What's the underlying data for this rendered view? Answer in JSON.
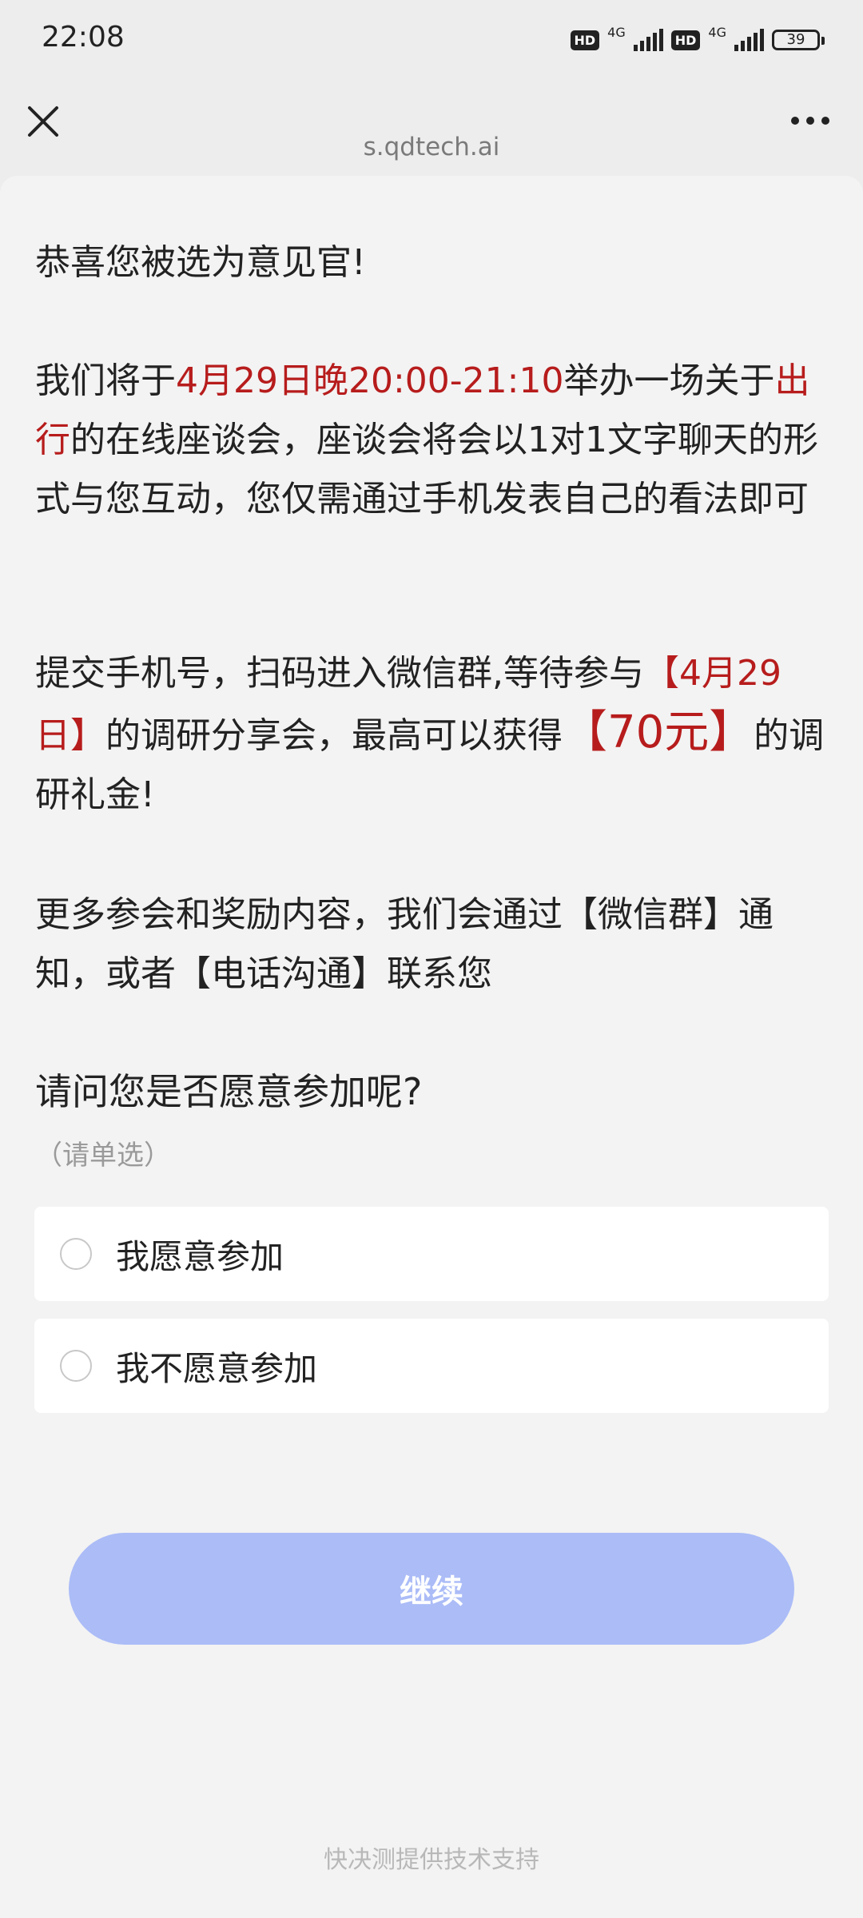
{
  "status_bar": {
    "time": "22:08",
    "sim1_badge": "HD",
    "sim1_network": "4G",
    "sim2_badge": "HD",
    "sim2_network": "4G",
    "battery": "39"
  },
  "nav": {
    "url": "s.qdtech.ai",
    "close_icon": "close-icon",
    "more_icon": "more-icon"
  },
  "intro": {
    "congrats": "恭喜您被选为意见官!",
    "p1_a": "我们将于",
    "p1_time": "4月29日晚20:00-21:10",
    "p1_b": "举办一场关于",
    "p1_topic": "出行",
    "p1_c": "的在线座谈会，座谈会将会以1对1文字聊天的形式与您互动，您仅需通过手机发表自己的看法即可",
    "p2_a": "提交手机号，扫码进入微信群,等待参与",
    "p2_date": "【4月29日】",
    "p2_b": "的调研分享会，最高可以获得",
    "p2_amount": "【70元】",
    "p2_c": "的调研礼金!",
    "p3": "更多参会和奖励内容，我们会通过【微信群】通知，或者【电话沟通】联系您"
  },
  "question": {
    "title": "请问您是否愿意参加呢?",
    "hint": "（请单选）",
    "options": [
      {
        "label": "我愿意参加"
      },
      {
        "label": "我不愿意参加"
      }
    ]
  },
  "actions": {
    "continue_label": "继续"
  },
  "footer": {
    "text": "快决测提供技术支持"
  },
  "colors": {
    "accent_red": "#b71c1c",
    "button_bg": "#abbcf7",
    "page_bg": "#f3f3f3"
  }
}
